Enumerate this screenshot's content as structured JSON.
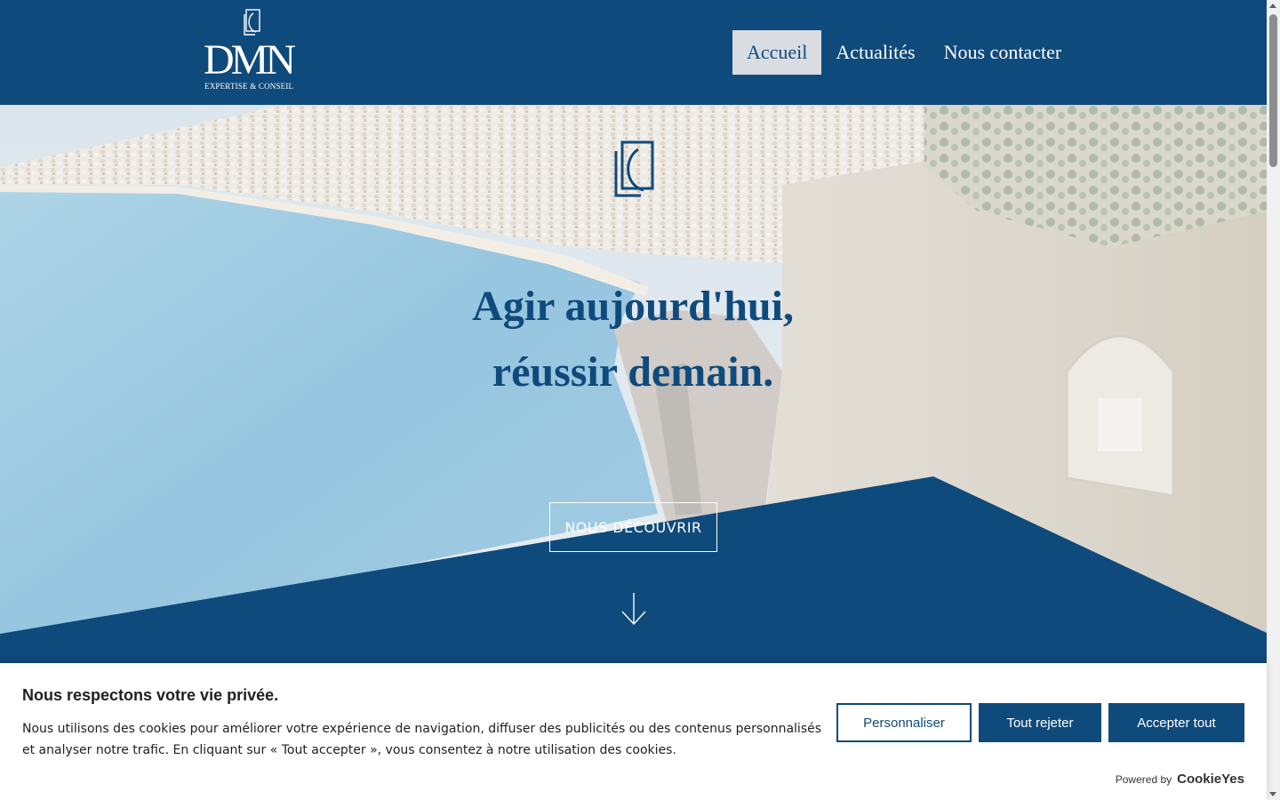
{
  "colors": {
    "brand_navy": "#0f4a7c",
    "nav_active_bg": "#d9dde2",
    "white": "#ffffff",
    "text_dark": "#212121"
  },
  "header": {
    "logo": {
      "wordmark": "DMN",
      "tagline": "EXPERTISE & CONSEIL",
      "icon": "dmn-monogram-icon"
    },
    "nav": [
      {
        "label": "Accueil",
        "active": true
      },
      {
        "label": "Actualités",
        "active": false
      },
      {
        "label": "Nous contacter",
        "active": false
      }
    ]
  },
  "hero": {
    "icon": "dmn-monogram-icon",
    "title_line1": "Agir aujourd'hui,",
    "title_line2": "réussir demain.",
    "cta_label": "NOUS DÉCOUVRIR",
    "scroll_icon": "arrow-down-icon",
    "background": "aerial-coastline-photo"
  },
  "cookie_banner": {
    "title": "Nous respectons votre vie privée.",
    "message": "Nous utilisons des cookies pour améliorer votre expérience de navigation, diffuser des publicités ou des contenus personnalisés et analyser notre trafic. En cliquant sur « Tout accepter », vous consentez à notre utilisation des cookies.",
    "buttons": {
      "customize": "Personnaliser",
      "reject": "Tout rejeter",
      "accept": "Accepter tout"
    },
    "powered_by_label": "Powered by",
    "powered_by_brand": "CookieYes"
  }
}
